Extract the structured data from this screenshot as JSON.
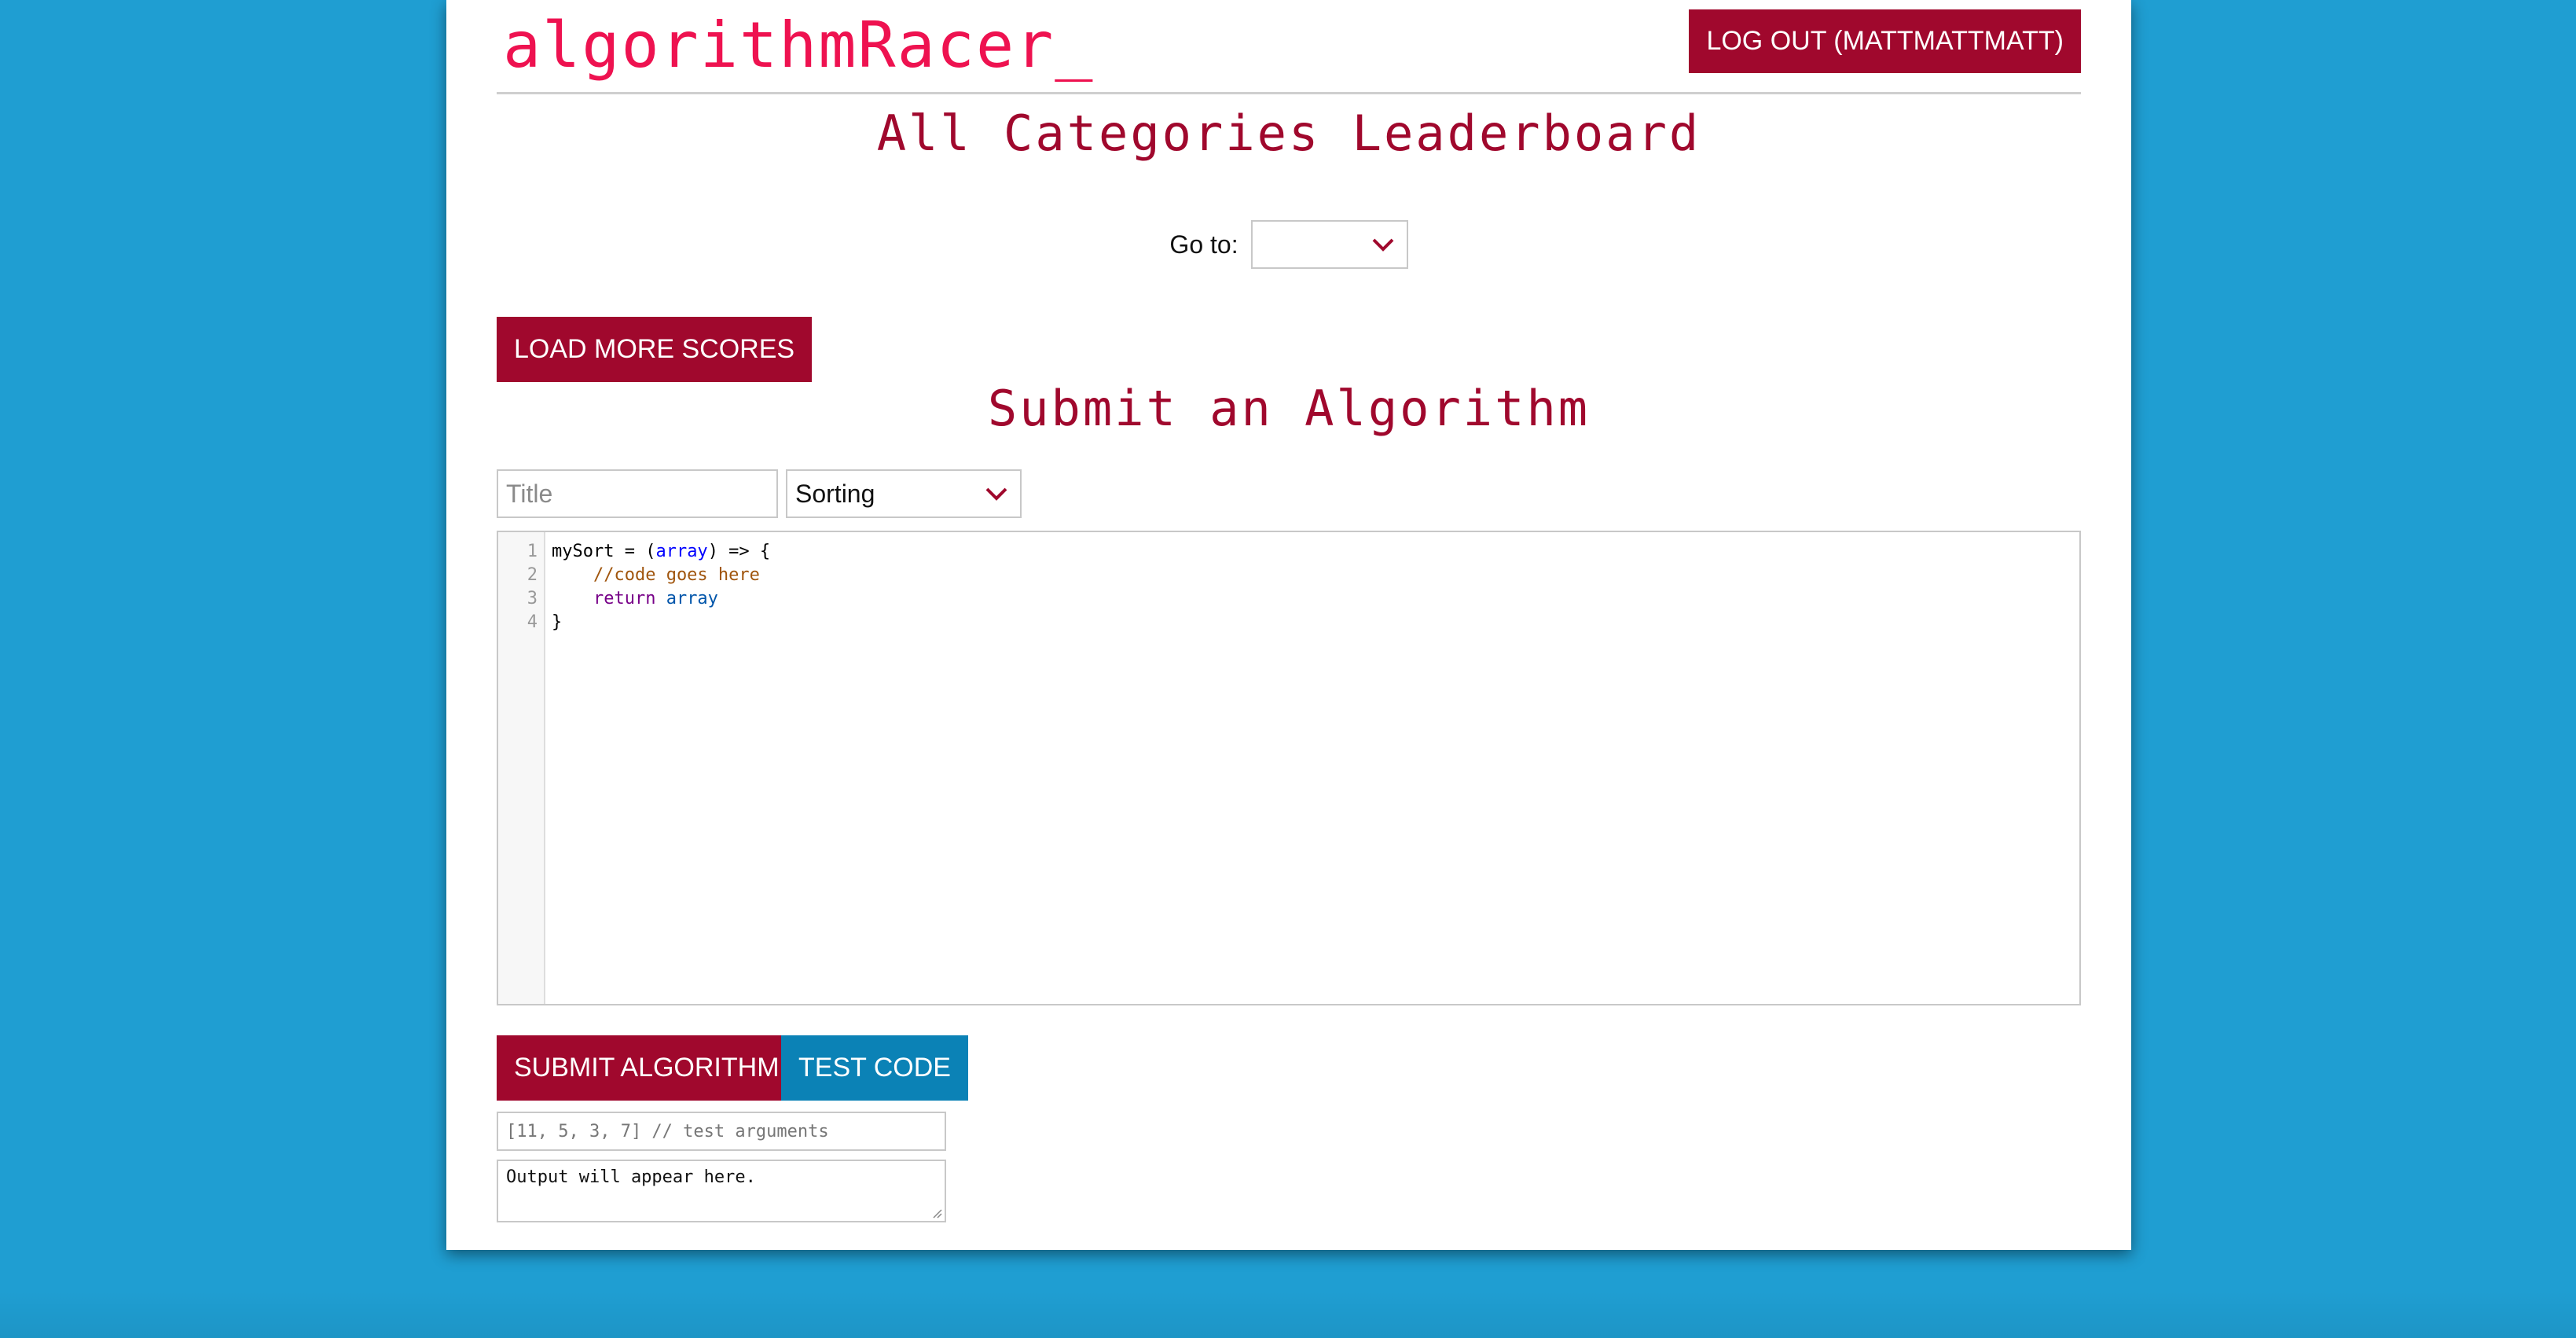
{
  "app": {
    "logo": "algorithmRacer_",
    "logout_label": "LOG OUT (MATTMATTMATT)"
  },
  "leaderboard": {
    "heading": "All Categories Leaderboard",
    "goto_label": "Go to:",
    "goto_value": "",
    "load_more_label": "LOAD MORE SCORES"
  },
  "submit": {
    "heading": "Submit an Algorithm",
    "title_placeholder": "Title",
    "category_value": "Sorting",
    "code_lines": [
      {
        "num": "1"
      },
      {
        "num": "2"
      },
      {
        "num": "3"
      },
      {
        "num": "4"
      }
    ],
    "code": {
      "line1_a": "mySort = (",
      "line1_b": "array",
      "line1_c": ") => {",
      "line2": "    //code goes here",
      "line3_kw": "    return",
      "line3_var": " array",
      "line4": "}"
    },
    "submit_label": "SUBMIT ALGORITHM",
    "test_label": "TEST CODE",
    "args_placeholder": "[11, 5, 3, 7] // test arguments",
    "output_text": "Output will appear here."
  },
  "colors": {
    "background": "#1f9ed2",
    "accent_dark": "#a0082d",
    "accent_blue": "#0b82b6",
    "logo": "#ee1250"
  },
  "icons": {
    "goto_chevron": "chevron-down-icon",
    "category_chevron": "chevron-down-icon"
  }
}
